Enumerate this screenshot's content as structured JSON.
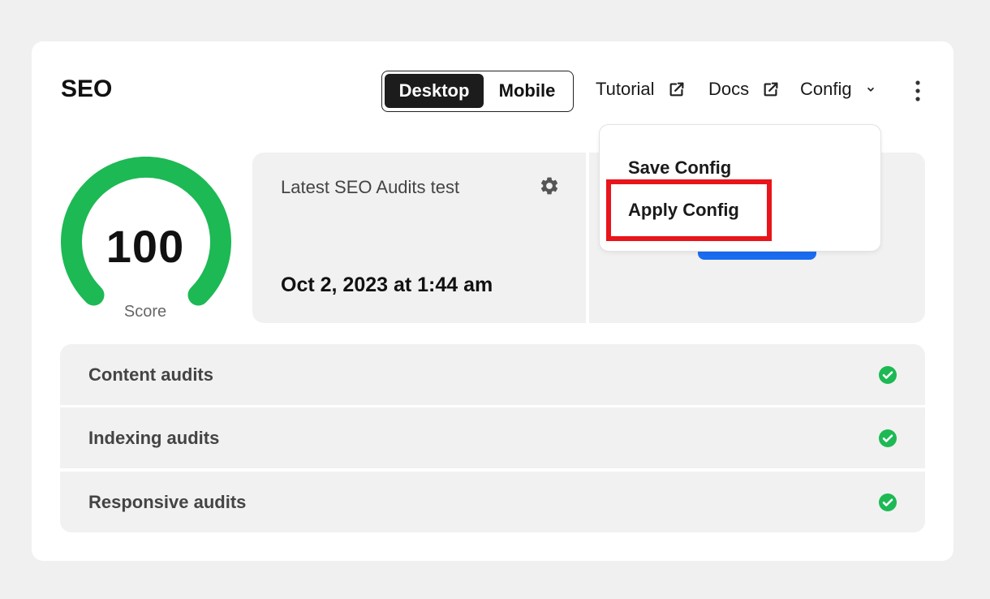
{
  "header": {
    "title": "SEO",
    "device_toggle": {
      "desktop": "Desktop",
      "mobile": "Mobile",
      "selected": "Desktop"
    },
    "tutorial_label": "Tutorial",
    "docs_label": "Docs",
    "config_label": "Config"
  },
  "score": {
    "value": "100",
    "label": "Score",
    "color": "#1db954"
  },
  "latest_test": {
    "label": "Latest SEO Audits test",
    "date": "Oct 2, 2023 at 1:44 am"
  },
  "config_menu": {
    "items": [
      {
        "label": "Save Config"
      },
      {
        "label": "Apply Config",
        "highlighted": true
      }
    ]
  },
  "audits": [
    {
      "label": "Content audits",
      "status": "passed"
    },
    {
      "label": "Indexing audits",
      "status": "passed"
    },
    {
      "label": "Responsive audits",
      "status": "passed"
    }
  ],
  "colors": {
    "accent": "#1a6cf0",
    "success": "#1db954",
    "highlight": "#e8151b"
  }
}
